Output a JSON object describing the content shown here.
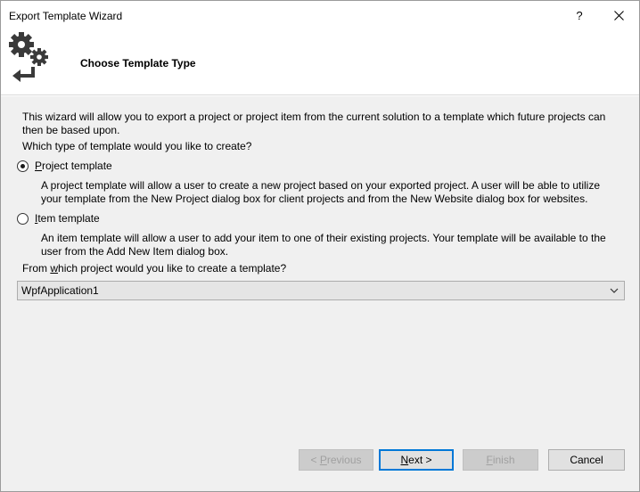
{
  "window": {
    "title": "Export Template Wizard",
    "help_glyph": "?",
    "close_icon": "close-icon"
  },
  "header": {
    "title": "Choose Template Type",
    "icon": "gears-arrow-icon"
  },
  "intro": {
    "line1": "This wizard will allow you to export a project or project item from the current solution to a template which future projects can",
    "line2": "then be based upon."
  },
  "question": "Which type of template would you like to create?",
  "options": [
    {
      "label_mnemonic": "P",
      "label_rest": "roject template",
      "selected": true,
      "desc_line1": "A project template will allow a user to create a new project based on your exported project. A user will be able to utilize",
      "desc_line2": "your template from the New Project dialog box for client projects and from the New Website dialog box for websites."
    },
    {
      "label_mnemonic": "I",
      "label_rest": "tem template",
      "selected": false,
      "desc_line1": "An item template will allow a user to add your item to one of their existing projects. Your template will be available to the",
      "desc_line2": "user from the Add New Item dialog box."
    }
  ],
  "project_question": {
    "before": "From ",
    "mnemonic": "w",
    "after": "hich project would you like to create a template?"
  },
  "project_select": {
    "value": "WpfApplication1"
  },
  "buttons": {
    "previous": {
      "prefix": "< ",
      "mnemonic": "P",
      "rest": "revious",
      "enabled": false
    },
    "next": {
      "mnemonic": "N",
      "rest": "ext >",
      "enabled": true
    },
    "finish": {
      "mnemonic": "F",
      "rest": "inish",
      "enabled": false
    },
    "cancel": {
      "label": "Cancel",
      "enabled": true
    }
  }
}
